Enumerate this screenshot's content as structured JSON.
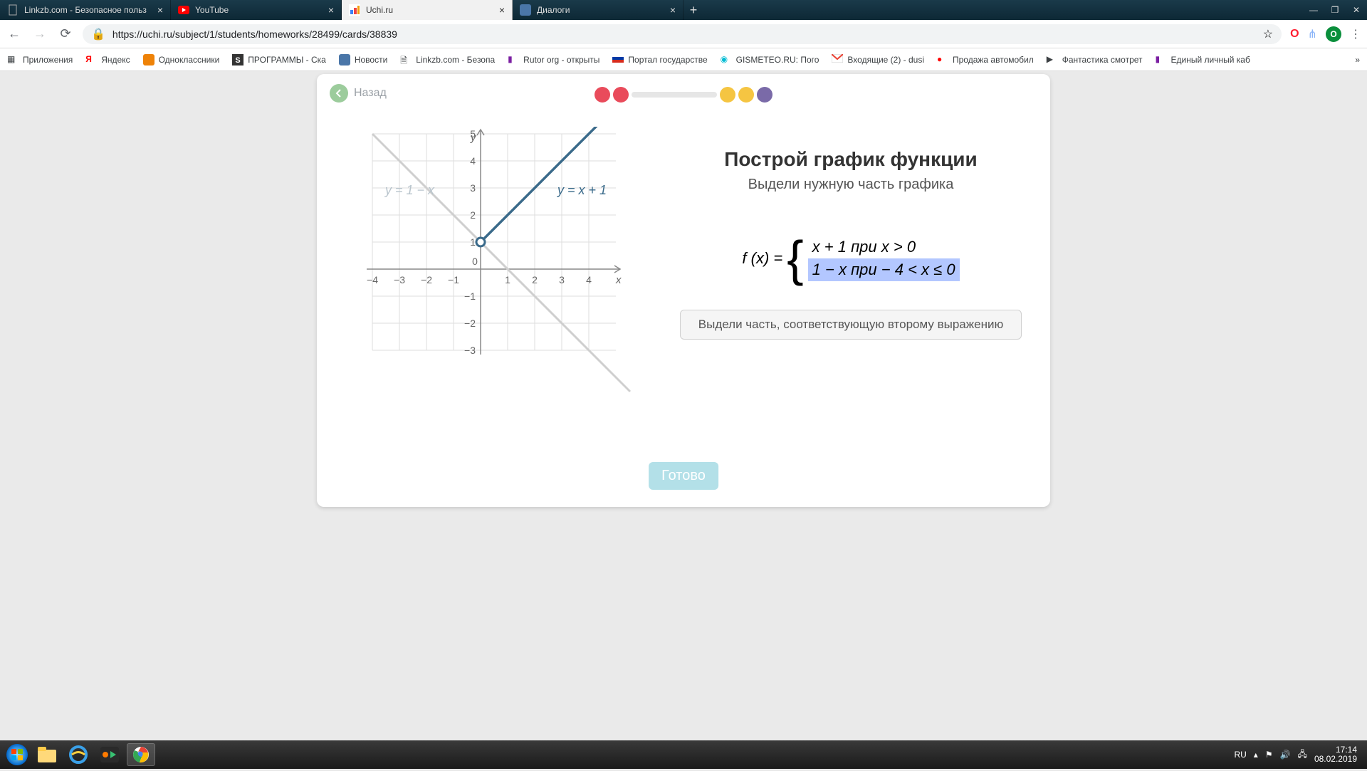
{
  "tabs": [
    {
      "title": "Linkzb.com - Безопасное польз",
      "active": false
    },
    {
      "title": "YouTube",
      "active": false
    },
    {
      "title": "Uchi.ru",
      "active": true
    },
    {
      "title": "Диалоги",
      "active": false
    }
  ],
  "url": "https://uchi.ru/subject/1/students/homeworks/28499/cards/38839",
  "bookmarks": [
    "Приложения",
    "Яндекс",
    "Одноклассники",
    "ПРОГРАММЫ - Ска",
    "Новости",
    "Linkzb.com - Безопа",
    "Rutor org - открыты",
    "Портал государстве",
    "GISMETEO.RU: Пого",
    "Входящие (2) - dusi",
    "Продажа автомобил",
    "Фантастика смотрет",
    "Единый личный каб"
  ],
  "back_label": "Назад",
  "task": {
    "title": "Построй график функции",
    "subtitle": "Выдели нужную часть графика",
    "fx_label": "f (x) = ",
    "case1": "x + 1 при x > 0",
    "case2": "1 − x при  − 4 < x ≤ 0",
    "hint": "Выдели часть, соответствующую второму выражению",
    "done": "Готово"
  },
  "graph": {
    "line1_label": "y = 1 − x",
    "line2_label": "y = x + 1",
    "y_label": "y",
    "x_label": "x",
    "x_ticks": [
      "−4",
      "−3",
      "−2",
      "−1",
      "0",
      "1",
      "2",
      "3",
      "4"
    ],
    "y_ticks_pos": [
      "5",
      "4",
      "3",
      "2",
      "1"
    ],
    "y_ticks_neg": [
      "−1",
      "−2",
      "−3"
    ]
  },
  "progress_colors": {
    "red": "#e94b5b",
    "yellow": "#f5c542",
    "purple": "#7a6aa8"
  },
  "tray": {
    "lang": "RU",
    "time": "17:14",
    "date": "08.02.2019"
  },
  "avatar_letter": "O"
}
